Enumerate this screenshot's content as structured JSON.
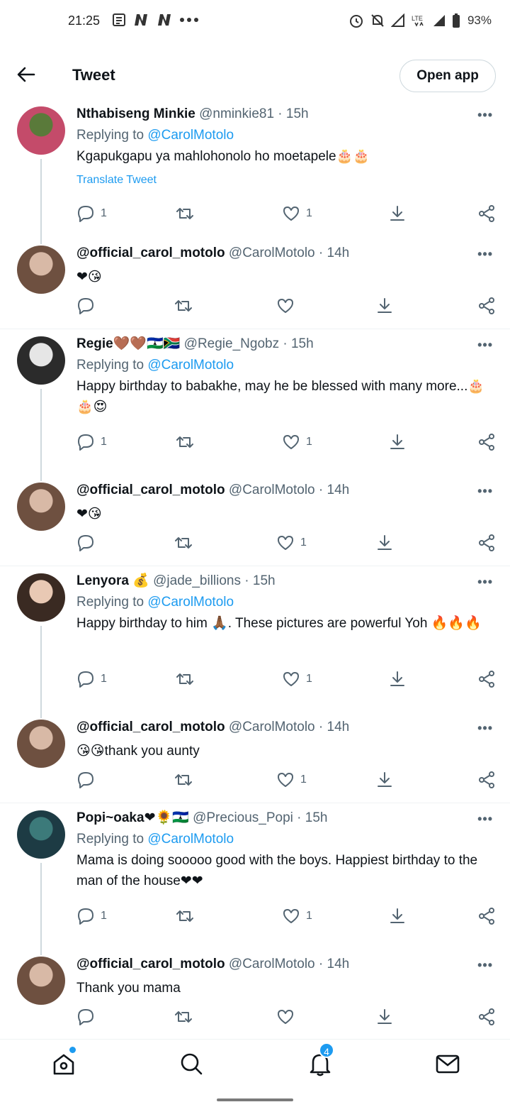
{
  "status_bar": {
    "time": "21:25",
    "left_icons": [
      "news-icon",
      "netflix-icon",
      "netflix-icon",
      "more-dots-icon"
    ],
    "right_icons": [
      "alarm-icon",
      "mute-icon",
      "signal-icon",
      "lte-icon",
      "signal-icon",
      "battery-icon"
    ],
    "battery": "93%"
  },
  "header": {
    "title": "Tweet",
    "open_app": "Open app"
  },
  "tweets": [
    {
      "name": "Nthabiseng Minkie",
      "handle": "@nminkie81 · 15h",
      "replying_prefix": "Replying to ",
      "replying_to": "@CarolMotolo",
      "text": "Kgapukgapu ya mahlohonolo ho moetapele🎂🎂",
      "translate": "Translate Tweet",
      "replies": "1",
      "likes": "1"
    },
    {
      "name": "@official_carol_motolo",
      "handle": "@CarolMotolo · 14h",
      "text": "❤😘",
      "replies": "",
      "likes": ""
    },
    {
      "name": "Regie🤎🤎🇱🇸🇿🇦",
      "handle": "@Regie_Ngobz · 15h",
      "replying_prefix": "Replying to ",
      "replying_to": "@CarolMotolo",
      "text": "Happy birthday to babakhe, may he be blessed with many more...🎂🎂😍",
      "replies": "1",
      "likes": "1"
    },
    {
      "name": "@official_carol_motolo",
      "handle": "@CarolMotolo · 14h",
      "text": "❤😘",
      "replies": "",
      "likes": "1"
    },
    {
      "name": "Lenyora 💰",
      "handle": "@jade_billions · 15h",
      "replying_prefix": "Replying to ",
      "replying_to": "@CarolMotolo",
      "text": "Happy birthday to him 🙏🏾. These pictures are powerful Yoh 🔥🔥🔥",
      "replies": "1",
      "likes": "1"
    },
    {
      "name": "@official_carol_motolo",
      "handle": "@CarolMotolo · 14h",
      "text": "😘😘thank you aunty",
      "replies": "",
      "likes": "1"
    },
    {
      "name": "Popi~oaka❤🌻🇱🇸",
      "handle": "@Precious_Popi · 15h",
      "replying_prefix": "Replying to ",
      "replying_to": "@CarolMotolo",
      "text": "Mama is doing sooooo good with the boys. Happiest birthday to the man of the house❤❤",
      "replies": "1",
      "likes": "1"
    },
    {
      "name": "@official_carol_motolo",
      "handle": "@CarolMotolo · 14h",
      "text": "Thank you mama",
      "replies": "",
      "likes": ""
    }
  ],
  "bottom_nav": {
    "items": [
      "home-icon",
      "search-icon",
      "notifications-icon",
      "messages-icon"
    ],
    "notifications_badge": "4"
  },
  "colors": {
    "accent": "#1d9bf0",
    "secondary_text": "#536471",
    "primary_text": "#0f1419",
    "divider": "#eff3f4"
  }
}
